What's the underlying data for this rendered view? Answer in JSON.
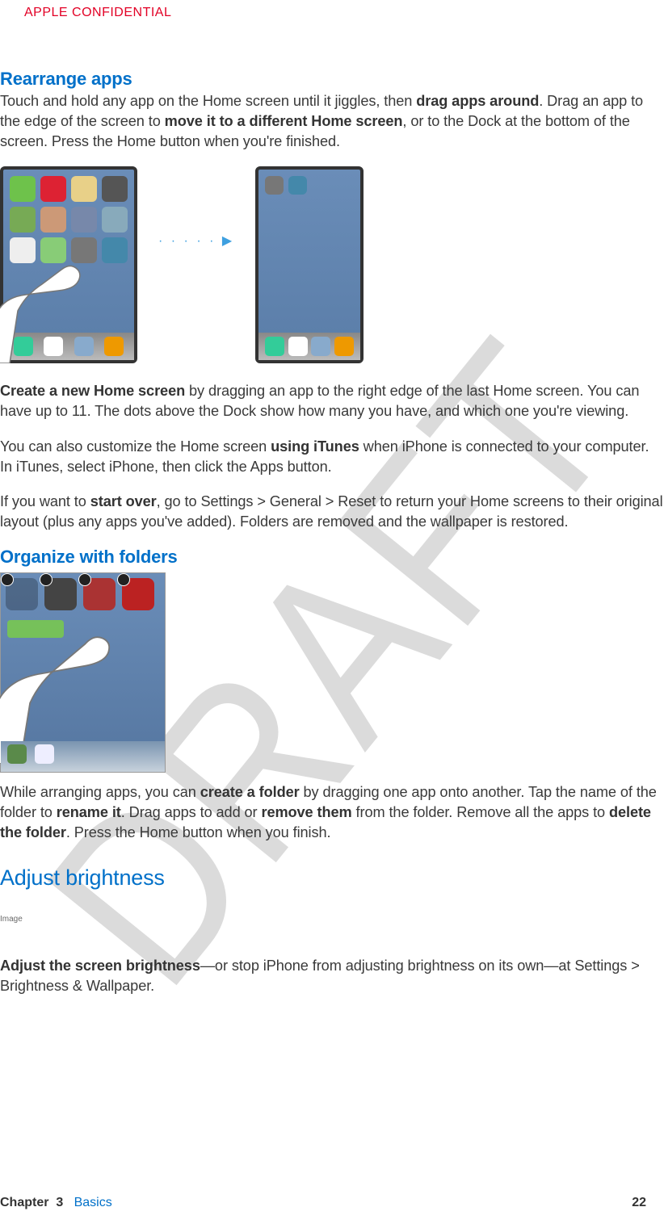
{
  "header": {
    "confidential": "APPLE CONFIDENTIAL"
  },
  "watermark": "DRAFT",
  "sections": {
    "rearrange": {
      "title": "Rearrange apps",
      "intro_pre": "Touch and hold any app on the Home screen until it jiggles, then ",
      "intro_b1": "drag apps around",
      "intro_mid1": ". Drag an app to the edge of the screen to ",
      "intro_b2": "move it to a different Home screen",
      "intro_post": ", or to the Dock at the bottom of the screen. Press the Home button when you're finished.",
      "arrow": "· · · · · ▶",
      "p2_b": "Create a new Home screen",
      "p2_rest": " by dragging an app to the right edge of the last Home screen. You can have up to 11. The dots above the Dock show how many you have, and which one you're viewing.",
      "p3_pre": "You can also customize the Home screen ",
      "p3_b": "using iTunes",
      "p3_post": " when iPhone is connected to your computer. In iTunes, select iPhone, then click the Apps button.",
      "p4_pre": "If you want to ",
      "p4_b": "start over",
      "p4_post": ", go to Settings > General > Reset to return your Home screens to their original layout (plus any apps you've added). Folders are removed and the wallpaper is restored."
    },
    "folders": {
      "title": "Organize with folders",
      "p1_pre": "While arranging apps, you can ",
      "p1_b1": "create a folder",
      "p1_mid1": " by dragging one app onto another. Tap the name of the folder to ",
      "p1_b2": "rename it",
      "p1_mid2": ". Drag apps to add or ",
      "p1_b3": "remove them",
      "p1_mid3": " from the folder. Remove all the apps to ",
      "p1_b4": "delete the folder",
      "p1_post": ". Press the Home button when you finish."
    },
    "brightness": {
      "title": "Adjust brightness",
      "placeholder": "Image",
      "p1_b": "Adjust the screen brightness",
      "p1_post": "—or stop iPhone from adjusting brightness on its own—at Settings > Brightness & Wallpaper."
    }
  },
  "footer": {
    "chapter_label": "Chapter",
    "chapter_num": "3",
    "chapter_title": "Basics",
    "page": "22"
  }
}
